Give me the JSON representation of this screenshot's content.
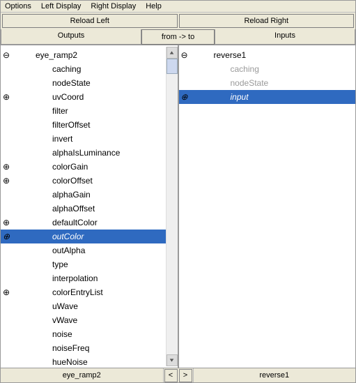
{
  "menu": {
    "options": "Options",
    "left": "Left Display",
    "right": "Right Display",
    "help": "Help"
  },
  "reload": {
    "left": "Reload Left",
    "right": "Reload Right"
  },
  "headers": {
    "outputs": "Outputs",
    "dir": "from -> to",
    "inputs": "Inputs"
  },
  "left_node": "eye_ramp2",
  "right_node": "reverse1",
  "left_attrs": [
    {
      "k": "caching",
      "exp": false
    },
    {
      "k": "nodeState",
      "exp": false
    },
    {
      "k": "uvCoord",
      "exp": true
    },
    {
      "k": "filter",
      "exp": false
    },
    {
      "k": "filterOffset",
      "exp": false
    },
    {
      "k": "invert",
      "exp": false
    },
    {
      "k": "alphaIsLuminance",
      "exp": false
    },
    {
      "k": "colorGain",
      "exp": true
    },
    {
      "k": "colorOffset",
      "exp": true
    },
    {
      "k": "alphaGain",
      "exp": false
    },
    {
      "k": "alphaOffset",
      "exp": false
    },
    {
      "k": "defaultColor",
      "exp": true
    },
    {
      "k": "outColor",
      "exp": true,
      "sel": true
    },
    {
      "k": "outAlpha",
      "exp": false
    },
    {
      "k": "type",
      "exp": false
    },
    {
      "k": "interpolation",
      "exp": false
    },
    {
      "k": "colorEntryList",
      "exp": true
    },
    {
      "k": "uWave",
      "exp": false
    },
    {
      "k": "vWave",
      "exp": false
    },
    {
      "k": "noise",
      "exp": false
    },
    {
      "k": "noiseFreq",
      "exp": false
    },
    {
      "k": "hueNoise",
      "exp": false
    }
  ],
  "right_attrs": [
    {
      "k": "caching",
      "muted": true
    },
    {
      "k": "nodeState",
      "muted": true
    },
    {
      "k": "input",
      "sel": true,
      "exp": true
    }
  ],
  "footer": {
    "left": "eye_ramp2",
    "right": "reverse1",
    "lt": "<",
    "gt": ">"
  }
}
